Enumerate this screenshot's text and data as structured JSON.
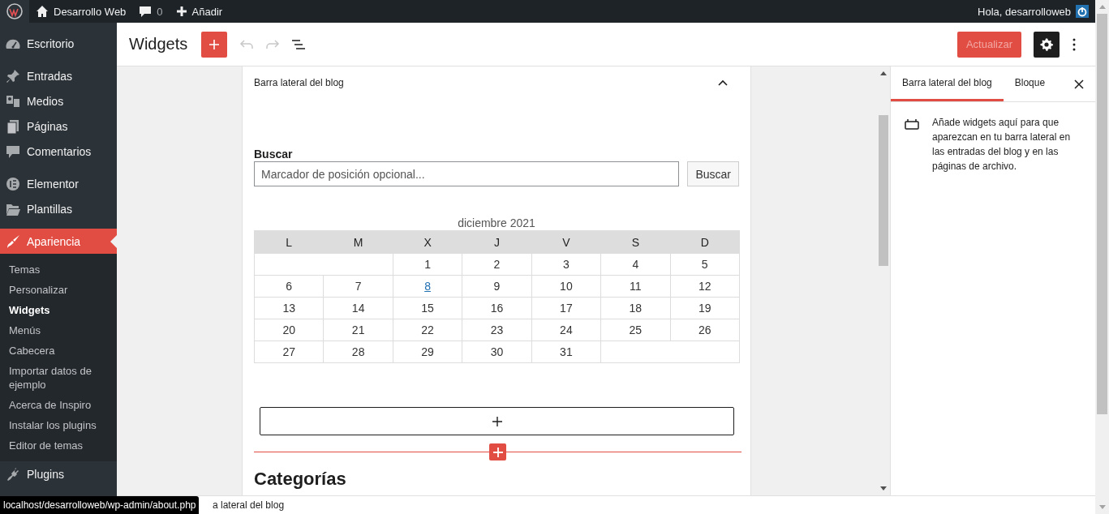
{
  "admin_bar": {
    "site_name": "Desarrollo Web",
    "comments": "0",
    "new": "Añadir",
    "greeting": "Hola, desarrolloweb"
  },
  "sidebar": {
    "groups": [
      [
        {
          "label": "Escritorio",
          "selected": false
        }
      ],
      [
        {
          "label": "Entradas",
          "selected": false
        },
        {
          "label": "Medios",
          "selected": false
        },
        {
          "label": "Páginas",
          "selected": false
        },
        {
          "label": "Comentarios",
          "selected": false
        }
      ],
      [
        {
          "label": "Elementor",
          "selected": false
        },
        {
          "label": "Plantillas",
          "selected": false
        }
      ],
      [
        {
          "label": "Apariencia",
          "selected": true,
          "expanded": true,
          "children": [
            {
              "label": "Temas",
              "selected": false
            },
            {
              "label": "Personalizar",
              "selected": false
            },
            {
              "label": "Widgets",
              "selected": true
            },
            {
              "label": "Menús",
              "selected": false
            },
            {
              "label": "Cabecera",
              "selected": false
            },
            {
              "label": "Importar datos de ejemplo",
              "selected": false
            },
            {
              "label": "Acerca de Inspiro",
              "selected": false
            },
            {
              "label": "Instalar los plugins",
              "selected": false
            },
            {
              "label": "Editor de temas",
              "selected": false
            }
          ]
        },
        {
          "label": "Plugins",
          "selected": false
        }
      ]
    ]
  },
  "header": {
    "title": "Widgets",
    "undo_disabled": true,
    "redo_disabled": true,
    "update": {
      "label": "Actualizar",
      "disabled": true
    },
    "settings_pressed": true
  },
  "area": {
    "title": "Barra lateral del blog",
    "expanded": true,
    "search": {
      "label": "Buscar",
      "placeholder": "Marcador de posición opcional...",
      "button": "Buscar"
    },
    "calendar": {
      "caption": "diciembre 2021",
      "weekdays": [
        "L",
        "M",
        "X",
        "J",
        "V",
        "S",
        "D"
      ],
      "weeks": [
        [
          {
            "d": "1",
            "link": false
          },
          {
            "d": "2",
            "link": false
          },
          {
            "d": "3",
            "link": false
          },
          {
            "d": "4",
            "link": false
          },
          {
            "d": "5",
            "link": false
          }
        ],
        [
          {
            "d": "6",
            "link": false
          },
          {
            "d": "7",
            "link": false
          },
          {
            "d": "8",
            "link": true
          },
          {
            "d": "9",
            "link": false
          },
          {
            "d": "10",
            "link": false
          },
          {
            "d": "11",
            "link": false
          },
          {
            "d": "12",
            "link": false
          }
        ],
        [
          {
            "d": "13",
            "link": false
          },
          {
            "d": "14",
            "link": false
          },
          {
            "d": "15",
            "link": false
          },
          {
            "d": "16",
            "link": false
          },
          {
            "d": "17",
            "link": false
          },
          {
            "d": "18",
            "link": false
          },
          {
            "d": "19",
            "link": false
          }
        ],
        [
          {
            "d": "20",
            "link": false
          },
          {
            "d": "21",
            "link": false
          },
          {
            "d": "22",
            "link": false
          },
          {
            "d": "23",
            "link": false
          },
          {
            "d": "24",
            "link": false
          },
          {
            "d": "25",
            "link": false
          },
          {
            "d": "26",
            "link": false
          }
        ],
        [
          {
            "d": "27",
            "link": false
          },
          {
            "d": "28",
            "link": false
          },
          {
            "d": "29",
            "link": false
          },
          {
            "d": "30",
            "link": false
          },
          {
            "d": "31",
            "link": false
          }
        ]
      ]
    },
    "heading": "Categorías"
  },
  "inspector": {
    "tabs": [
      {
        "label": "Barra lateral del blog",
        "selected": true
      },
      {
        "label": "Bloque",
        "selected": false
      }
    ],
    "description": "Añade widgets aquí para que aparezcan en tu barra lateral en las entradas del blog y en las páginas de archivo."
  },
  "footer": {
    "breadcrumb": "a lateral del blog"
  },
  "status_url": "localhost/desarrolloweb/wp-admin/about.php"
}
